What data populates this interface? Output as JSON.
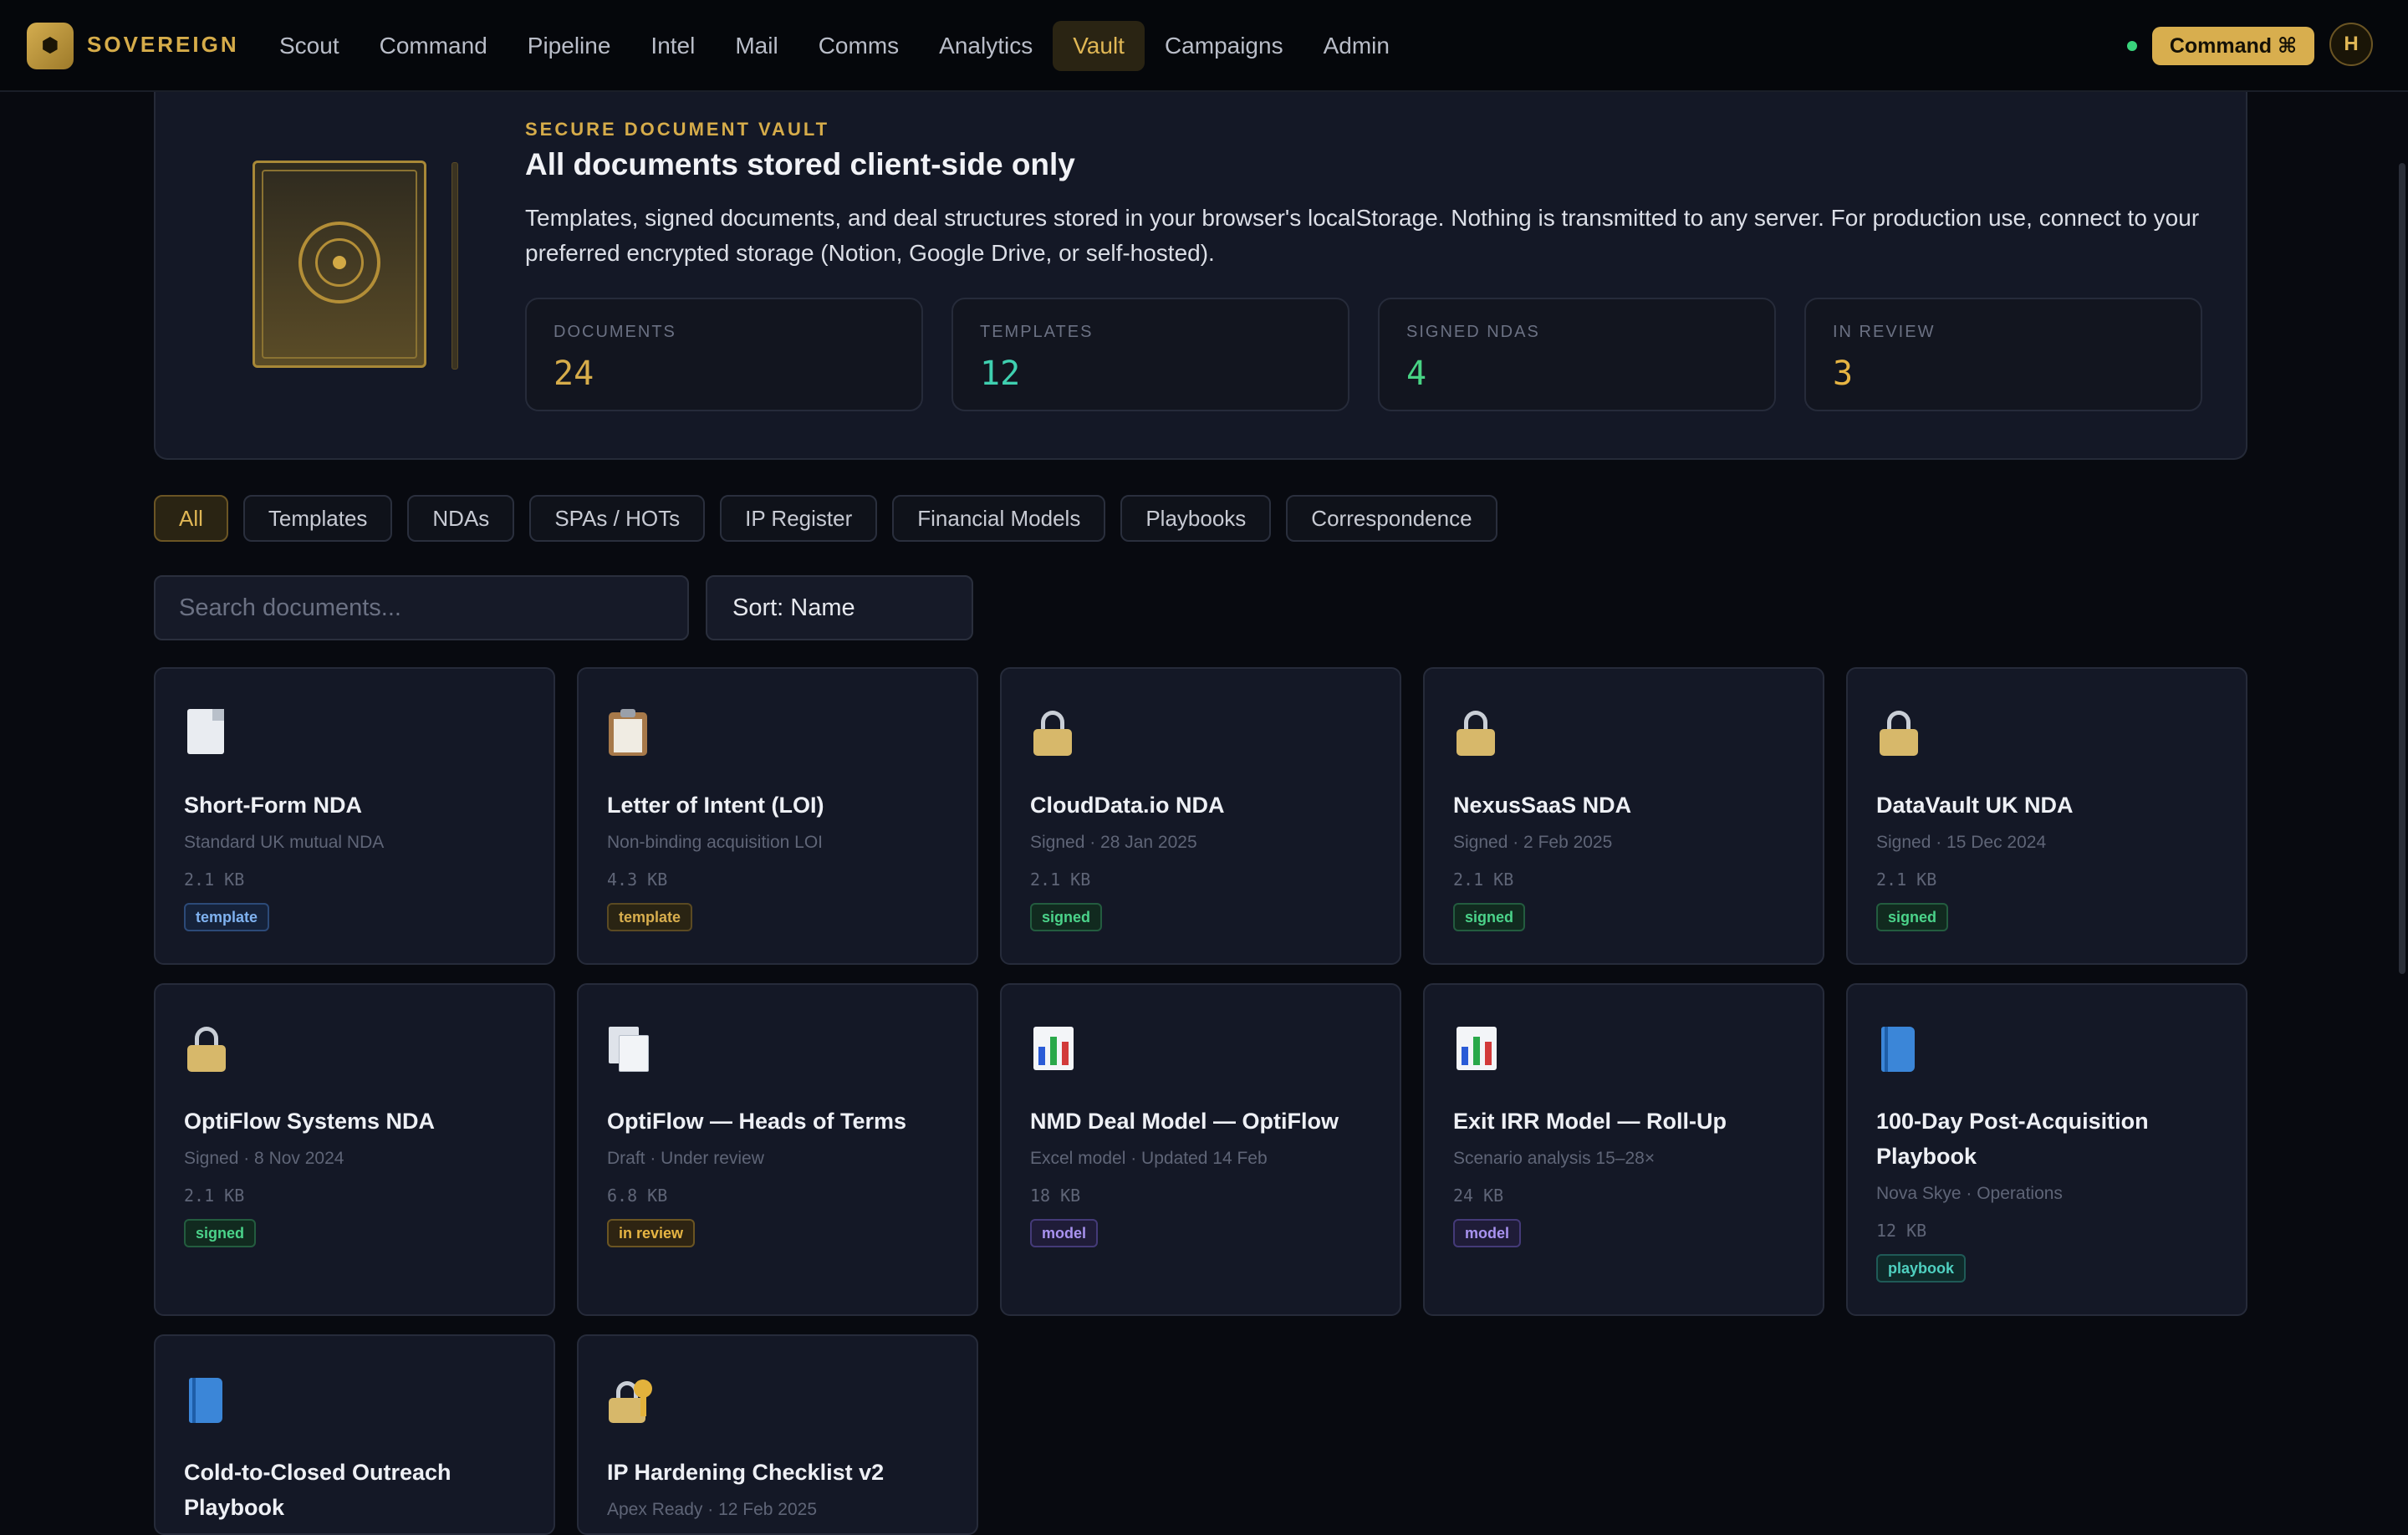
{
  "app": {
    "brand": "SOVEREIGN",
    "nav": [
      "Scout",
      "Command",
      "Pipeline",
      "Intel",
      "Mail",
      "Comms",
      "Analytics",
      "Vault",
      "Campaigns",
      "Admin"
    ],
    "active_nav": "Vault",
    "command_button": "Command ⌘",
    "avatar_initial": "H",
    "status": "online"
  },
  "hero": {
    "eyebrow": "SECURE DOCUMENT VAULT",
    "title": "All documents stored client-side only",
    "description": "Templates, signed documents, and deal structures stored in your browser's localStorage. Nothing is transmitted to any server. For production use, connect to your preferred encrypted storage (Notion, Google Drive, or self-hosted).",
    "stats": [
      {
        "label": "DOCUMENTS",
        "value": "24",
        "color": "#d6ac4a"
      },
      {
        "label": "TEMPLATES",
        "value": "12",
        "color": "#3fd0b0"
      },
      {
        "label": "SIGNED NDAS",
        "value": "4",
        "color": "#48d384"
      },
      {
        "label": "IN REVIEW",
        "value": "3",
        "color": "#e7b543"
      }
    ]
  },
  "filters": [
    "All",
    "Templates",
    "NDAs",
    "SPAs / HOTs",
    "IP Register",
    "Financial Models",
    "Playbooks",
    "Correspondence"
  ],
  "active_filter": "All",
  "search": {
    "placeholder": "Search documents...",
    "value": ""
  },
  "sort": {
    "label": "Sort: Name"
  },
  "documents": [
    {
      "icon": "document-icon",
      "title": "Short-Form NDA",
      "subtitle": "Standard UK mutual NDA",
      "size": "2.1 KB",
      "tag": "template"
    },
    {
      "icon": "clipboard-icon",
      "title": "Letter of Intent (LOI)",
      "subtitle": "Non-binding acquisition LOI",
      "size": "4.3 KB",
      "tag": "template"
    },
    {
      "icon": "lock-icon",
      "title": "CloudData.io NDA",
      "subtitle": "Signed · 28 Jan 2025",
      "size": "2.1 KB",
      "tag": "signed"
    },
    {
      "icon": "lock-icon",
      "title": "NexusSaaS NDA",
      "subtitle": "Signed · 2 Feb 2025",
      "size": "2.1 KB",
      "tag": "signed"
    },
    {
      "icon": "lock-icon",
      "title": "DataVault UK NDA",
      "subtitle": "Signed · 15 Dec 2024",
      "size": "2.1 KB",
      "tag": "signed"
    },
    {
      "icon": "lock-icon",
      "title": "OptiFlow Systems NDA",
      "subtitle": "Signed · 8 Nov 2024",
      "size": "2.1 KB",
      "tag": "signed"
    },
    {
      "icon": "documents-icon",
      "title": "OptiFlow — Heads of Terms",
      "subtitle": "Draft · Under review",
      "size": "6.8 KB",
      "tag": "in review"
    },
    {
      "icon": "bar-chart-icon",
      "title": "NMD Deal Model — OptiFlow",
      "subtitle": "Excel model · Updated 14 Feb",
      "size": "18 KB",
      "tag": "model"
    },
    {
      "icon": "bar-chart-icon",
      "title": "Exit IRR Model — Roll-Up",
      "subtitle": "Scenario analysis 15–28×",
      "size": "24 KB",
      "tag": "model"
    },
    {
      "icon": "book-icon",
      "title": "100-Day Post-Acquisition Playbook",
      "subtitle": "Nova Skye · Operations",
      "size": "12 KB",
      "tag": "playbook"
    },
    {
      "icon": "book-icon",
      "title": "Cold-to-Closed Outreach Playbook",
      "subtitle": "",
      "size": "",
      "tag": ""
    },
    {
      "icon": "lock-key-icon",
      "title": "IP Hardening Checklist v2",
      "subtitle": "Apex Ready · 12 Feb 2025",
      "size": "",
      "tag": ""
    }
  ]
}
